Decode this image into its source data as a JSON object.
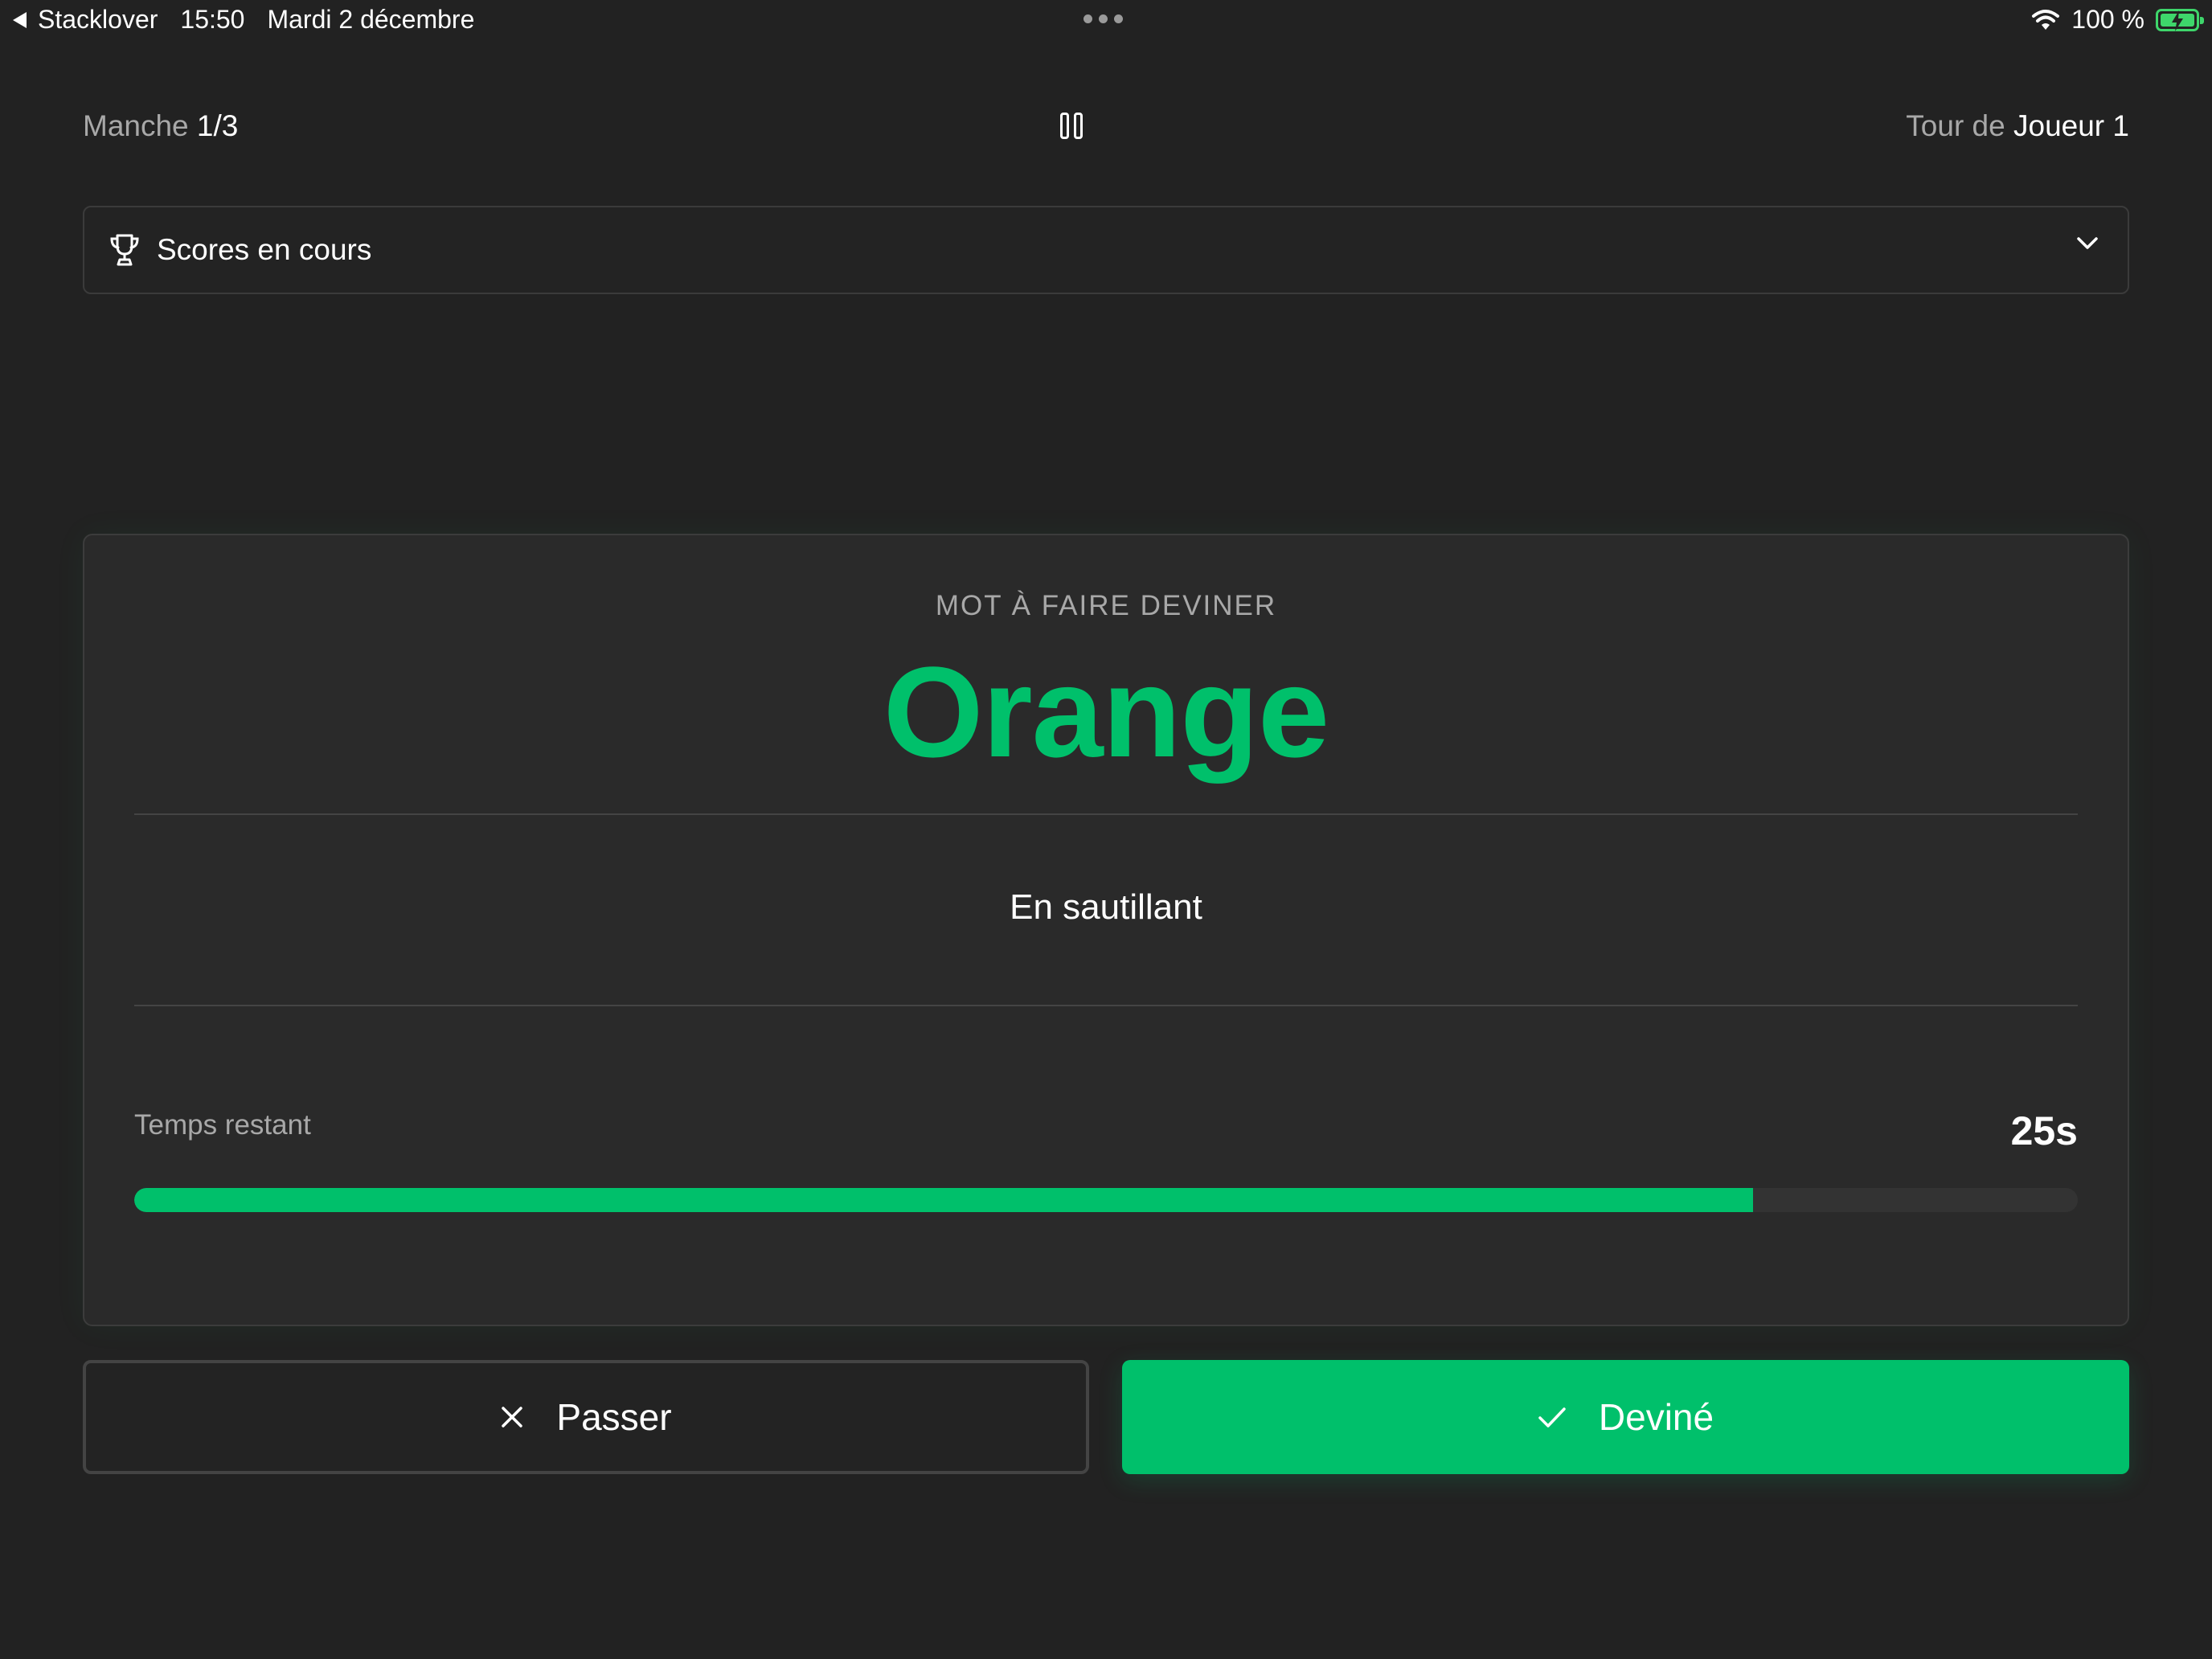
{
  "status_bar": {
    "back_app": "Stacklover",
    "time": "15:50",
    "date": "Mardi 2 décembre",
    "battery": "100 %",
    "battery_color": "#3ed66b"
  },
  "header": {
    "round_prefix": "Manche",
    "round_value": "1/3",
    "turn_prefix": "Tour de",
    "turn_value": "Joueur 1"
  },
  "scores": {
    "label": "Scores en cours",
    "icon": "trophy-icon",
    "expand_icon": "chevron-down-icon"
  },
  "card": {
    "label": "MOT À FAIRE DEVINER",
    "word": "Orange",
    "hint": "En sautillant",
    "time_label": "Temps restant",
    "time_value": "25s",
    "time_fraction_remaining": 0.833
  },
  "actions": {
    "skip_label": "Passer",
    "skip_icon": "close-icon",
    "guessed_label": "Deviné",
    "guessed_icon": "check-icon"
  },
  "colors": {
    "accent": "#00c06b",
    "background": "#222222",
    "card": "#2a2a2a"
  }
}
